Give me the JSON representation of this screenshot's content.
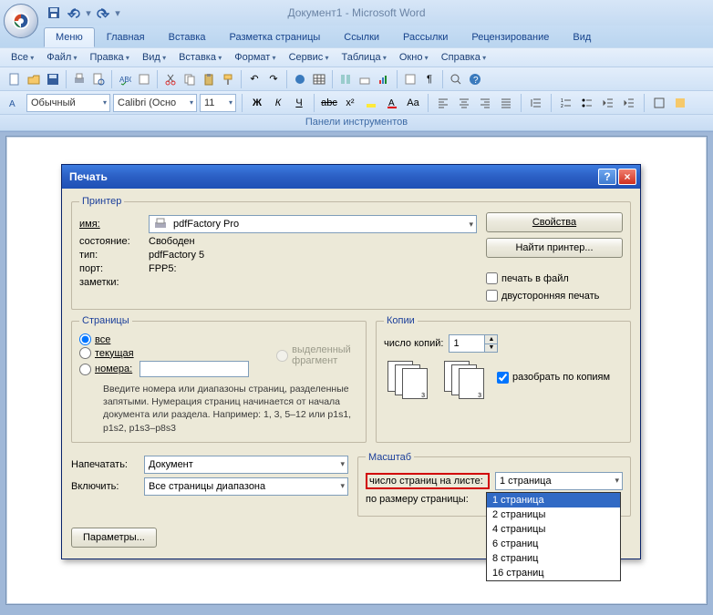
{
  "title": "Документ1 - Microsoft Word",
  "qat": {
    "save": "save",
    "undo": "undo",
    "redo": "redo"
  },
  "tabs": {
    "items": [
      "Меню",
      "Главная",
      "Вставка",
      "Разметка страницы",
      "Ссылки",
      "Рассылки",
      "Рецензирование",
      "Вид"
    ],
    "activeIndex": 0
  },
  "menubar": {
    "all": "Все",
    "file": "Файл",
    "edit": "Правка",
    "view": "Вид",
    "insert": "Вставка",
    "format": "Формат",
    "tools": "Сервис",
    "table": "Таблица",
    "window": "Окно",
    "help": "Справка"
  },
  "format_bar": {
    "style": "Обычный",
    "font": "Calibri (Осно",
    "size": "11"
  },
  "panel_label": "Панели инструментов",
  "dialog": {
    "title": "Печать",
    "help": "?",
    "close": "×",
    "printer": {
      "legend": "Принтер",
      "name_label": "имя:",
      "name_value": "pdfFactory Pro",
      "status_label": "состояние:",
      "status_value": "Свободен",
      "type_label": "тип:",
      "type_value": "pdfFactory 5",
      "port_label": "порт:",
      "port_value": "FPP5:",
      "notes_label": "заметки:",
      "props_btn": "Свойства",
      "find_btn": "Найти принтер...",
      "to_file": "печать в файл",
      "duplex": "двусторонняя печать"
    },
    "pages": {
      "legend": "Страницы",
      "all": "все",
      "current": "текущая",
      "selection": "выделенный фрагмент",
      "numbers": "номера:",
      "hint": "Введите номера или диапазоны страниц, разделенные запятыми. Нумерация страниц начинается от начала документа или раздела. Например: 1, 3, 5–12 или p1s1, p1s2, p1s3–p8s3"
    },
    "copies": {
      "legend": "Копии",
      "count_label": "число копий:",
      "count_value": "1",
      "collate": "разобрать по копиям"
    },
    "print_what": {
      "label": "Напечатать:",
      "value": "Документ"
    },
    "include": {
      "label": "Включить:",
      "value": "Все страницы диапазона"
    },
    "scale": {
      "legend": "Масштаб",
      "pps_label": "число страниц на листе:",
      "pps_value": "1 страница",
      "fit_label": "по размеру страницы:",
      "options": [
        "1 страница",
        "2 страницы",
        "4 страницы",
        "6 страниц",
        "8 страниц",
        "16 страниц"
      ]
    },
    "params_btn": "Параметры..."
  }
}
